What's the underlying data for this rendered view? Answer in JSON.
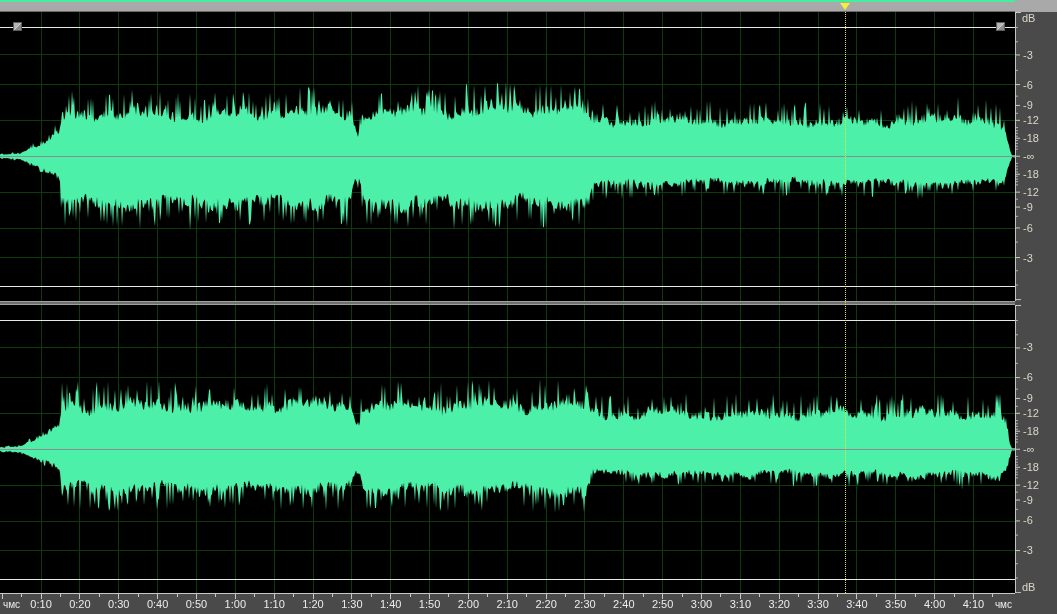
{
  "overview_bar": {
    "playhead": {
      "level": 0.833
    }
  },
  "channels": [
    {
      "scale_top": "dB",
      "db_scale": [
        "-3",
        "-6",
        "-9",
        "-12",
        "-18",
        "-∞",
        "-18",
        "-12",
        "-9",
        "-6",
        "-3"
      ],
      "envelope_handles": true
    },
    {
      "db_scale": [
        "-3",
        "-6",
        "-9",
        "-12",
        "-18",
        "-∞",
        "-18",
        "-12",
        "-9",
        "-6",
        "-3"
      ],
      "scale_bottom": "dB",
      "envelope_handles": false
    }
  ],
  "time_ruler": {
    "unit_start": "чмс",
    "labels": [
      "0:10",
      "0:20",
      "0:30",
      "0:40",
      "0:50",
      "1:00",
      "1:10",
      "1:20",
      "1:30",
      "1:40",
      "1:50",
      "2:00",
      "2:10",
      "2:20",
      "2:30",
      "2:40",
      "2:50",
      "3:00",
      "3:10",
      "3:20",
      "3:30",
      "3:40",
      "3:50",
      "4:00",
      "4:10"
    ],
    "unit_end": "чмс"
  }
}
